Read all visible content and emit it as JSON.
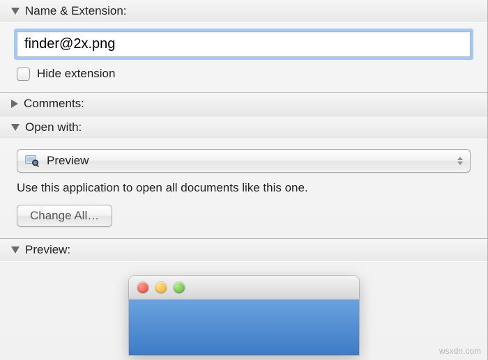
{
  "sections": {
    "name_ext": {
      "title": "Name & Extension:",
      "expanded": true
    },
    "comments": {
      "title": "Comments:",
      "expanded": false
    },
    "open_with": {
      "title": "Open with:",
      "expanded": true
    },
    "preview": {
      "title": "Preview:",
      "expanded": true
    }
  },
  "name_extension": {
    "value": "finder@2x.png",
    "hide_extension_label": "Hide extension",
    "hide_extension_checked": false
  },
  "open_with": {
    "app_name": "Preview",
    "hint": "Use this application to open all documents like this one.",
    "change_all_label": "Change All…"
  },
  "watermark": "wsxdn.com"
}
